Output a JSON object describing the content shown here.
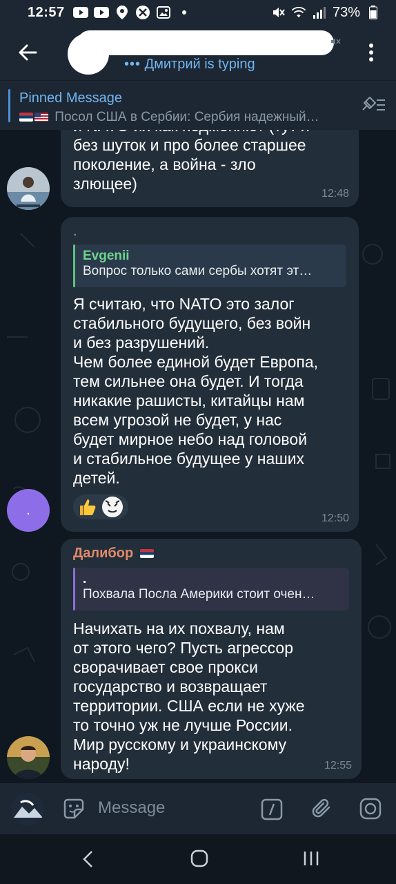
{
  "status_bar": {
    "time": "12:57",
    "battery": "73%"
  },
  "header": {
    "typing_dots": "•••",
    "typing_text": "Дмитрий is typing"
  },
  "pinned": {
    "label": "Pinned Message",
    "text": "Посол США в Сербии: Сербия надежный…"
  },
  "messages": [
    {
      "text": "и NATO их как подменяют (тут я\nбез шуток и про более старшее\nпоколение, а война - зло\nзлющее)",
      "time": "12:48"
    },
    {
      "sender": ".",
      "reply_name": "Evgenii",
      "reply_text": "Вопрос только сами сербы хотят эт…",
      "text": "Я считаю, что NATO это залог\nстабильного будущего, без войн\nи без разрушений.\nЧем более единой будет Европа,\nтем сильнее она будет. И тогда\nникакие рашисты, китайцы нам\nвсем угрозой не будет, у нас\nбудет мирное небо над головой\nи стабильное будущее у наших\nдетей.",
      "reactions": [
        "thumbs-up",
        "character"
      ],
      "time": "12:50",
      "avatar_text": "."
    },
    {
      "sender": "Далибор",
      "reply_name": ".",
      "reply_text": "Похвала Посла Америки стоит очен…",
      "text": "Начихать на их похвалу, нам\nот этого чего? Пусть агрессор\nсворачивает свое прокси\nгосударство и возвращает\nтерритории. США если не хуже\nто точно уж не лучше России.\nМир русскому и украинскому\nнароду!",
      "time": "12:55"
    }
  ],
  "input": {
    "placeholder": "Message"
  },
  "colors": {
    "accent": "#72b5f0",
    "bubble": "#222e3a",
    "header_bg": "#1d2733",
    "chat_bg": "#0f1720",
    "reply_green": "#5ec27f",
    "sender_orange": "#e08a6a",
    "avatar_purple": "#8e6ee8"
  }
}
